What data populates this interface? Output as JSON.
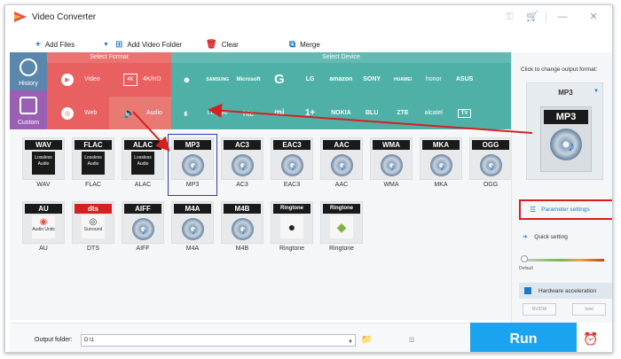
{
  "app": {
    "title": "Video Converter"
  },
  "toolbar": {
    "add_files": "Add Files",
    "add_video_folder": "Add Video Folder",
    "clear": "Clear",
    "merge": "Merge"
  },
  "sidebar": {
    "history": "History",
    "custom": "Custom"
  },
  "select_format": {
    "header": "Select Format",
    "items": [
      "Video",
      "4K/HD",
      "Web",
      "Audio"
    ]
  },
  "select_device": {
    "header": "Select Device",
    "row1": [
      "",
      "SAMSUNG",
      "Microsoft",
      "G",
      "LG",
      "amazon",
      "SONY",
      "HUAWEI",
      "honor",
      "ASUS"
    ],
    "row2": [
      "",
      "Lenovo",
      "htc",
      "mi",
      "1+",
      "NOKIA",
      "BLU",
      "ZTE",
      "alcatel",
      "TV"
    ]
  },
  "formats": {
    "row1": [
      "WAV",
      "FLAC",
      "ALAC",
      "MP3",
      "AC3",
      "EAC3",
      "AAC",
      "WMA",
      "MKA",
      "OGG"
    ],
    "row2": [
      "AU",
      "DTS",
      "AIFF",
      "M4A",
      "M4B",
      "Ringtone",
      "Ringtone"
    ],
    "row2_headers": [
      "AU",
      "dts",
      "AIFF",
      "M4A",
      "M4B",
      "Ringtone",
      "Ringtone"
    ],
    "lossless_text": "Lossless Audio",
    "au_sub": "Audio Units",
    "dts_sub": "Surround"
  },
  "output": {
    "label": "Output folder:",
    "value": "D:\\1"
  },
  "run": {
    "label": "Run"
  },
  "right_panel": {
    "caption": "Click to change output format:",
    "format": "MP3",
    "parameter_settings": "Parameter settings",
    "quick_setting": "Quick setting",
    "default_label": "Default",
    "hardware_acceleration": "Hardware acceleration",
    "nvidia": "NVIDIA",
    "intel": "Intel"
  },
  "colors": {
    "format_red": "#e8605f",
    "device_teal": "#4fb0a8",
    "run_blue": "#1aa3ef",
    "annotation_red": "#d6201f",
    "selection_blue": "#2b3eb8"
  }
}
